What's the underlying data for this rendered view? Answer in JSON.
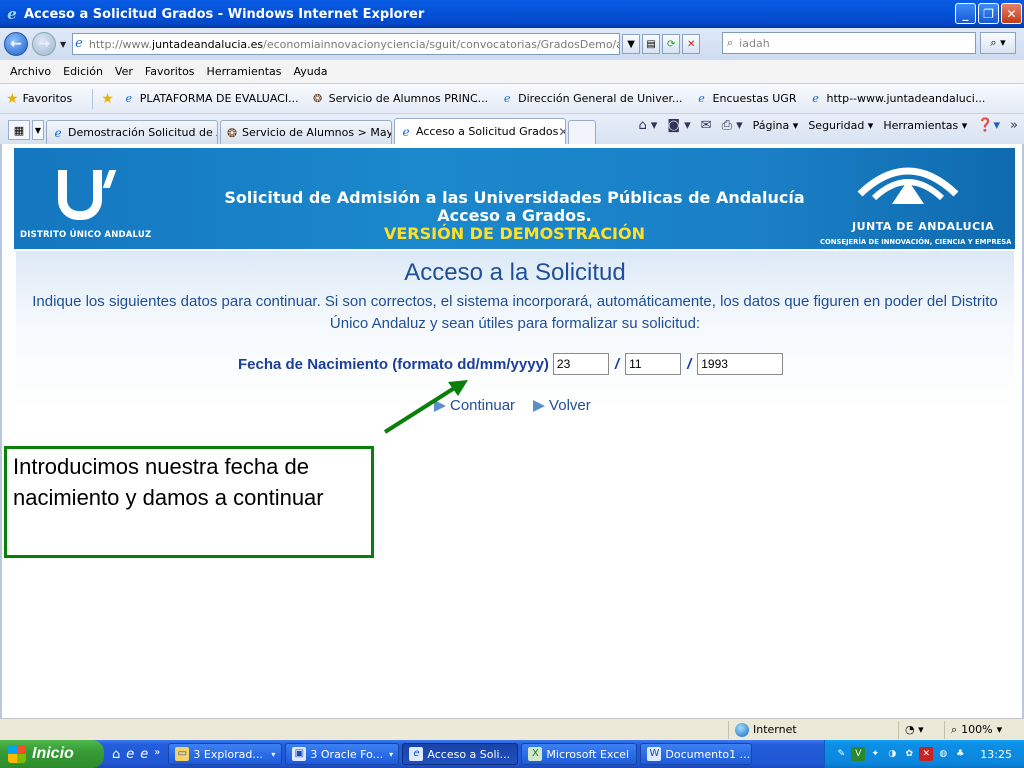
{
  "window": {
    "title": "Acceso a Solicitud Grados - Windows Internet Explorer"
  },
  "address": {
    "url_prefix": "http://www.",
    "url_domain": "juntadeandalucia.es",
    "url_rest": "/economiainnovacionyciencia/sguit/convocatorias/GradosDemo/acceso2.",
    "search_value": "iadah"
  },
  "menu": [
    "Archivo",
    "Edición",
    "Ver",
    "Favoritos",
    "Herramientas",
    "Ayuda"
  ],
  "favorites": {
    "label": "Favoritos",
    "items": [
      {
        "label": "PLATAFORMA DE EVALUACI...",
        "icon": "ie-page-icon"
      },
      {
        "label": "Servicio de Alumnos  PRINC...",
        "icon": "university-seal-icon"
      },
      {
        "label": "Dirección General de Univer...",
        "icon": "ie-page-icon"
      },
      {
        "label": "Encuestas UGR",
        "icon": "ie-page-icon"
      },
      {
        "label": "http--www.juntadeandaluci...",
        "icon": "ie-page-icon"
      }
    ]
  },
  "tabs": [
    {
      "label": "Demostración Solicitud de A...",
      "icon": "ie-page-icon"
    },
    {
      "label": "Servicio de Alumnos > May...",
      "icon": "university-seal-icon"
    },
    {
      "label": "Acceso a Solicitud Grados",
      "icon": "ie-page-icon",
      "active": true
    }
  ],
  "commandbar": {
    "pagina": "Página",
    "seguridad": "Seguridad",
    "herramientas": "Herramientas"
  },
  "banner": {
    "dua": "DISTRITO ÚNICO ANDALUZ",
    "line1": "Solicitud de Admisión a las Universidades Públicas de Andalucía",
    "line2": "Acceso a Grados.",
    "line3": "VERSIÓN DE DEMOSTRACIÓN",
    "junta": "JUNTA DE ANDALUCIA",
    "consejeria": "CONSEJERÍA DE INNOVACIÓN, CIENCIA Y EMPRESA"
  },
  "page": {
    "title": "Acceso a la Solicitud",
    "intro": "Indique los siguientes datos para continuar. Si son correctos, el sistema incorporará, automáticamente, los datos que figuren en poder del Distrito Único Andaluz y sean útiles para formalizar su solicitud:",
    "birth_label": "Fecha de Nacimiento (formato dd/mm/yyyy)",
    "day": "23",
    "month": "11",
    "year": "1993",
    "separator": "/",
    "continue_label": "Continuar",
    "back_label": "Volver"
  },
  "callout": {
    "text": "Introducimos nuestra fecha de nacimiento y damos a continuar"
  },
  "status": {
    "zone": "Internet",
    "zoom": "100%"
  },
  "taskbar": {
    "start": "Inicio",
    "items": [
      {
        "label": "3 Explorad...",
        "dropdown": true
      },
      {
        "label": "3 Oracle Fo...",
        "dropdown": true
      },
      {
        "label": "Acceso a Soli...",
        "active": true
      },
      {
        "label": "Microsoft Excel"
      },
      {
        "label": "Documento1 ..."
      }
    ],
    "clock": "13:25"
  },
  "colors": {
    "accent_green": "#0a7f0a",
    "banner_blue": "#1b88cc",
    "title_blue": "#1f4f96"
  }
}
